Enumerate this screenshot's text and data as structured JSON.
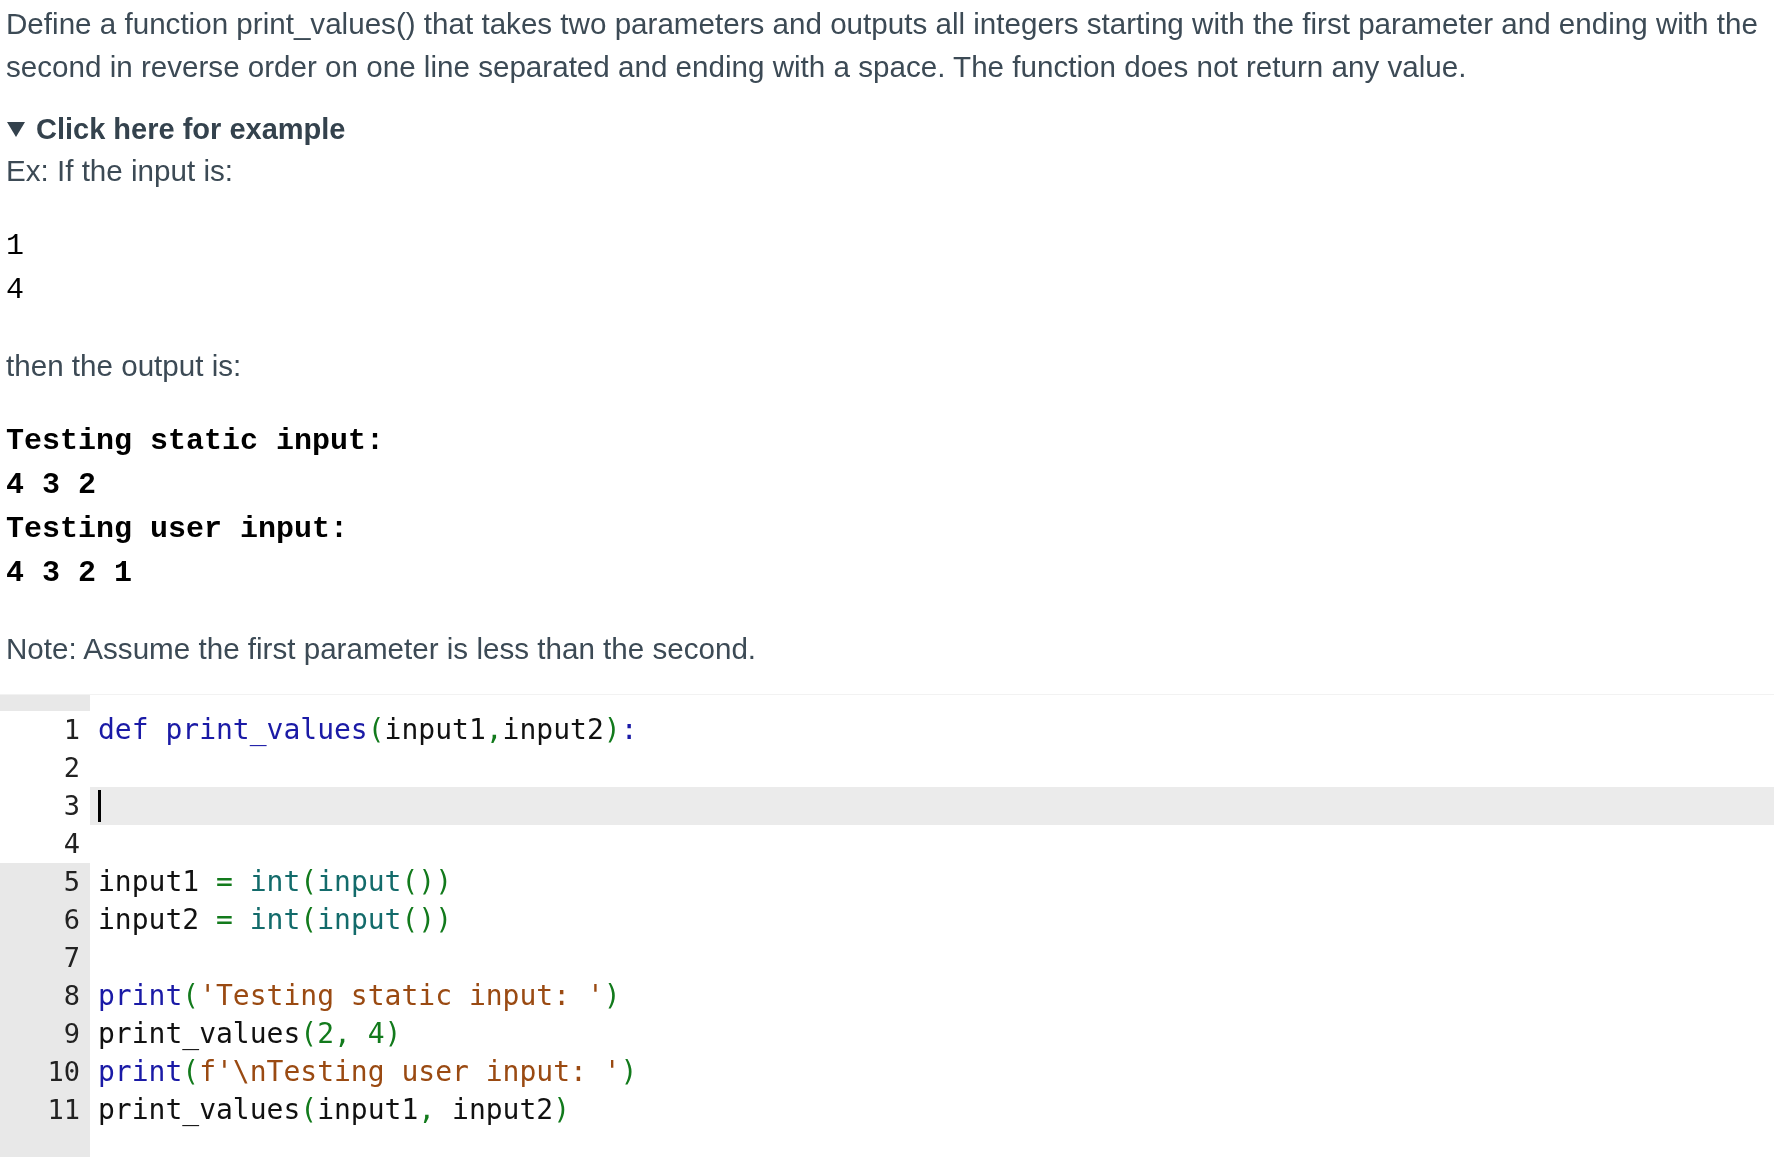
{
  "description": "Define a function print_values() that takes two parameters and outputs all integers starting with the first parameter and ending with the second in reverse order on one line separated and ending with a space. The function does not return any value.",
  "example": {
    "summary": "Click here for example",
    "expanded": true,
    "intro": "Ex: If the input is:",
    "input_lines": [
      "1",
      "4"
    ],
    "output_intro": "then the output is:",
    "output_lines": [
      "Testing static input:",
      "4 3 2",
      "Testing user input:",
      "4 3 2 1"
    ]
  },
  "note": "Note: Assume the first parameter is less than the second.",
  "editor": {
    "lines": [
      {
        "number": "1",
        "editable": true,
        "active": false,
        "tokens": [
          {
            "kind": "keyword",
            "text": "def "
          },
          {
            "kind": "keyword",
            "text": "print_values"
          },
          {
            "kind": "bracket",
            "text": "("
          },
          {
            "kind": "plain",
            "text": "input1"
          },
          {
            "kind": "bracket",
            "text": ","
          },
          {
            "kind": "plain",
            "text": "input2"
          },
          {
            "kind": "bracket",
            "text": ")"
          },
          {
            "kind": "keyword",
            "text": ":"
          }
        ]
      },
      {
        "number": "2",
        "editable": true,
        "active": false
      },
      {
        "number": "3",
        "editable": true,
        "active": true
      },
      {
        "number": "4",
        "editable": true,
        "active": false
      },
      {
        "number": "5",
        "editable": false,
        "active": false,
        "tokens": [
          {
            "kind": "plain",
            "text": "input1 "
          },
          {
            "kind": "bracket",
            "text": "= "
          },
          {
            "kind": "builtin",
            "text": "int"
          },
          {
            "kind": "bracket",
            "text": "("
          },
          {
            "kind": "builtin",
            "text": "input"
          },
          {
            "kind": "bracket",
            "text": "())"
          }
        ]
      },
      {
        "number": "6",
        "editable": false,
        "active": false,
        "tokens": [
          {
            "kind": "plain",
            "text": "input2 "
          },
          {
            "kind": "bracket",
            "text": "= "
          },
          {
            "kind": "builtin",
            "text": "int"
          },
          {
            "kind": "bracket",
            "text": "("
          },
          {
            "kind": "builtin",
            "text": "input"
          },
          {
            "kind": "bracket",
            "text": "())"
          }
        ]
      },
      {
        "number": "7",
        "editable": false,
        "active": false
      },
      {
        "number": "8",
        "editable": false,
        "active": false,
        "tokens": [
          {
            "kind": "keyword",
            "text": "print"
          },
          {
            "kind": "bracket",
            "text": "("
          },
          {
            "kind": "string",
            "text": "'Testing static input: '"
          },
          {
            "kind": "bracket",
            "text": ")"
          }
        ]
      },
      {
        "number": "9",
        "editable": false,
        "active": false,
        "tokens": [
          {
            "kind": "plain",
            "text": "print_values"
          },
          {
            "kind": "bracket",
            "text": "("
          },
          {
            "kind": "bracket",
            "text": "2, 4"
          },
          {
            "kind": "bracket",
            "text": ")"
          }
        ]
      },
      {
        "number": "10",
        "editable": false,
        "active": false,
        "tokens": [
          {
            "kind": "keyword",
            "text": "print"
          },
          {
            "kind": "bracket",
            "text": "("
          },
          {
            "kind": "string",
            "text": "f'\\nTesting user input: '"
          },
          {
            "kind": "bracket",
            "text": ")"
          }
        ]
      },
      {
        "number": "11",
        "editable": false,
        "active": false,
        "tokens": [
          {
            "kind": "plain",
            "text": "print_values"
          },
          {
            "kind": "bracket",
            "text": "("
          },
          {
            "kind": "plain",
            "text": "input1"
          },
          {
            "kind": "bracket",
            "text": ","
          },
          {
            "kind": "plain",
            "text": " input2"
          },
          {
            "kind": "bracket",
            "text": ")"
          }
        ]
      }
    ]
  }
}
